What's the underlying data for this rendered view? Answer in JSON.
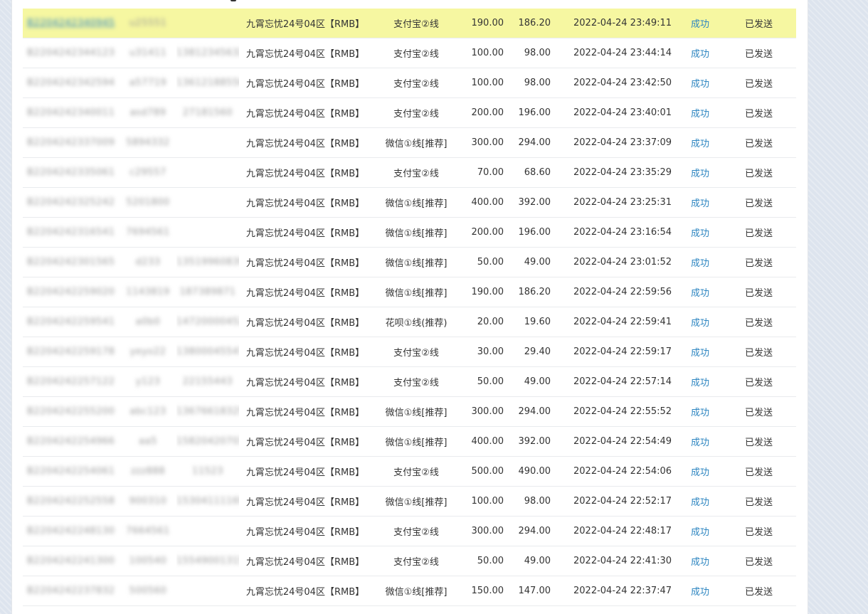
{
  "table": {
    "rows": [
      {
        "order_id": "B2204242340945",
        "user": "u25551",
        "phone": "",
        "server": "九霄忘忧24号04区【RMB】",
        "channel": "支付宝②线",
        "amount": "190.00",
        "paid": "186.20",
        "time": "2022-04-24 23:49:11",
        "status": "成功",
        "send": "已发送",
        "highlight": true
      },
      {
        "order_id": "B2204242344123",
        "user": "u31411",
        "phone": "13812345632",
        "server": "九霄忘忧24号04区【RMB】",
        "channel": "支付宝②线",
        "amount": "100.00",
        "paid": "98.00",
        "time": "2022-04-24 23:44:14",
        "status": "成功",
        "send": "已发送"
      },
      {
        "order_id": "B2204242342594",
        "user": "a57719",
        "phone": "13612188556",
        "server": "九霄忘忧24号04区【RMB】",
        "channel": "支付宝②线",
        "amount": "100.00",
        "paid": "98.00",
        "time": "2022-04-24 23:42:50",
        "status": "成功",
        "send": "已发送"
      },
      {
        "order_id": "B2204242340011",
        "user": "asd789",
        "phone": "27181560",
        "server": "九霄忘忧24号04区【RMB】",
        "channel": "支付宝②线",
        "amount": "200.00",
        "paid": "196.00",
        "time": "2022-04-24 23:40:01",
        "status": "成功",
        "send": "已发送"
      },
      {
        "order_id": "B2204242337009",
        "user": "5894332",
        "phone": "",
        "server": "九霄忘忧24号04区【RMB】",
        "channel": "微信①线[推荐]",
        "amount": "300.00",
        "paid": "294.00",
        "time": "2022-04-24 23:37:09",
        "status": "成功",
        "send": "已发送"
      },
      {
        "order_id": "B2204242335061",
        "user": "c29557",
        "phone": "",
        "server": "九霄忘忧24号04区【RMB】",
        "channel": "支付宝②线",
        "amount": "70.00",
        "paid": "68.60",
        "time": "2022-04-24 23:35:29",
        "status": "成功",
        "send": "已发送"
      },
      {
        "order_id": "B2204242325242",
        "user": "5201800",
        "phone": "",
        "server": "九霄忘忧24号04区【RMB】",
        "channel": "微信①线[推荐]",
        "amount": "400.00",
        "paid": "392.00",
        "time": "2022-04-24 23:25:31",
        "status": "成功",
        "send": "已发送"
      },
      {
        "order_id": "B2204242316541",
        "user": "7694561",
        "phone": "",
        "server": "九霄忘忧24号04区【RMB】",
        "channel": "微信①线[推荐]",
        "amount": "200.00",
        "paid": "196.00",
        "time": "2022-04-24 23:16:54",
        "status": "成功",
        "send": "已发送"
      },
      {
        "order_id": "B2204242301565",
        "user": "d233",
        "phone": "13519960839",
        "server": "九霄忘忧24号04区【RMB】",
        "channel": "微信①线[推荐]",
        "amount": "50.00",
        "paid": "49.00",
        "time": "2022-04-24 23:01:52",
        "status": "成功",
        "send": "已发送"
      },
      {
        "order_id": "B2204242259020",
        "user": "1143819",
        "phone": "187389871",
        "server": "九霄忘忧24号04区【RMB】",
        "channel": "微信①线[推荐]",
        "amount": "190.00",
        "paid": "186.20",
        "time": "2022-04-24 22:59:56",
        "status": "成功",
        "send": "已发送"
      },
      {
        "order_id": "B2204242259541",
        "user": "a0b0",
        "phone": "14720000452",
        "server": "九霄忘忧24号04区【RMB】",
        "channel": "花呗①线(推荐)",
        "amount": "20.00",
        "paid": "19.60",
        "time": "2022-04-24 22:59:41",
        "status": "成功",
        "send": "已发送"
      },
      {
        "order_id": "B2204242259178",
        "user": "yeyo22",
        "phone": "13800045547",
        "server": "九霄忘忧24号04区【RMB】",
        "channel": "支付宝②线",
        "amount": "30.00",
        "paid": "29.40",
        "time": "2022-04-24 22:59:17",
        "status": "成功",
        "send": "已发送"
      },
      {
        "order_id": "B2204242257122",
        "user": "y123",
        "phone": "22155443",
        "server": "九霄忘忧24号04区【RMB】",
        "channel": "支付宝②线",
        "amount": "50.00",
        "paid": "49.00",
        "time": "2022-04-24 22:57:14",
        "status": "成功",
        "send": "已发送"
      },
      {
        "order_id": "B2204242255200",
        "user": "abc123",
        "phone": "13676618325",
        "server": "九霄忘忧24号04区【RMB】",
        "channel": "微信①线[推荐]",
        "amount": "300.00",
        "paid": "294.00",
        "time": "2022-04-24 22:55:52",
        "status": "成功",
        "send": "已发送"
      },
      {
        "order_id": "B2204242254966",
        "user": "aa5",
        "phone": "15820420703",
        "server": "九霄忘忧24号04区【RMB】",
        "channel": "微信①线[推荐]",
        "amount": "400.00",
        "paid": "392.00",
        "time": "2022-04-24 22:54:49",
        "status": "成功",
        "send": "已发送"
      },
      {
        "order_id": "B2204242254061",
        "user": "zzz888",
        "phone": "11523",
        "server": "九霄忘忧24号04区【RMB】",
        "channel": "支付宝②线",
        "amount": "500.00",
        "paid": "490.00",
        "time": "2022-04-24 22:54:06",
        "status": "成功",
        "send": "已发送"
      },
      {
        "order_id": "B2204242252558",
        "user": "900310",
        "phone": "15304111169",
        "server": "九霄忘忧24号04区【RMB】",
        "channel": "微信①线[推荐]",
        "amount": "100.00",
        "paid": "98.00",
        "time": "2022-04-24 22:52:17",
        "status": "成功",
        "send": "已发送"
      },
      {
        "order_id": "B2204242248130",
        "user": "7664561",
        "phone": "",
        "server": "九霄忘忧24号04区【RMB】",
        "channel": "支付宝②线",
        "amount": "300.00",
        "paid": "294.00",
        "time": "2022-04-24 22:48:17",
        "status": "成功",
        "send": "已发送"
      },
      {
        "order_id": "B2204242241300",
        "user": "100540",
        "phone": "15549001315",
        "server": "九霄忘忧24号04区【RMB】",
        "channel": "支付宝②线",
        "amount": "50.00",
        "paid": "49.00",
        "time": "2022-04-24 22:41:30",
        "status": "成功",
        "send": "已发送"
      },
      {
        "order_id": "B2204242237832",
        "user": "500560",
        "phone": "",
        "server": "九霄忘忧24号04区【RMB】",
        "channel": "微信①线[推荐]",
        "amount": "150.00",
        "paid": "147.00",
        "time": "2022-04-24 22:37:47",
        "status": "成功",
        "send": "已发送"
      }
    ]
  },
  "colors": {
    "highlight_row": "#f6f7a1",
    "link": "#2e86c1",
    "page_bg": "#dde4ee"
  }
}
